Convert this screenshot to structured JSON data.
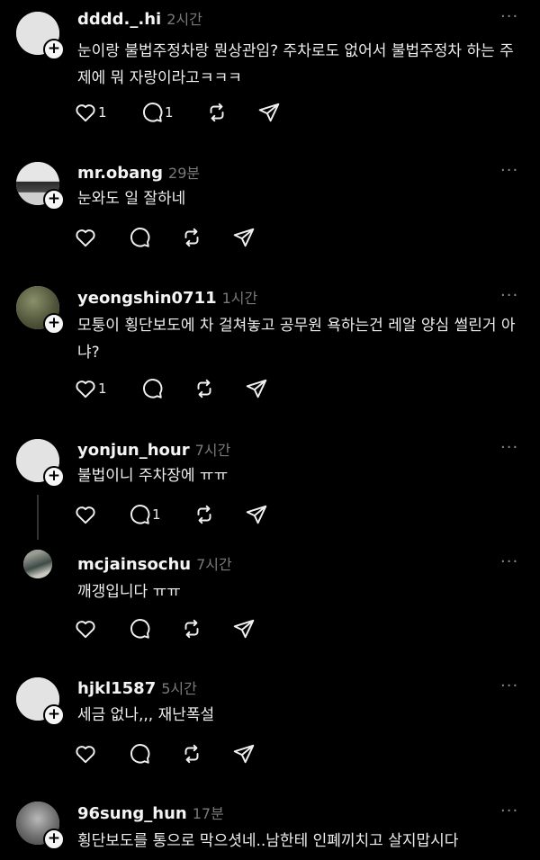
{
  "icons": {
    "like": "heart-icon",
    "reply": "reply-bubble-icon",
    "repost": "repost-icon",
    "share": "share-send-icon",
    "more": "more-dots-icon",
    "follow": "plus-icon"
  },
  "ui": {
    "more_glyph": "···",
    "follow_glyph": "+"
  },
  "colors": {
    "background": "#000000",
    "text": "#eeeeee",
    "muted": "#7a7a7a"
  },
  "comments": [
    {
      "username": "dddd._.hi",
      "time": "2시간",
      "text": "눈이랑 불법주정차랑 뭔상관임? 주차로도 없어서 불법주정차 하는 주제에 뭐 자랑이라고ㅋㅋㅋ",
      "likes": "1",
      "replies": "1"
    },
    {
      "username": "mr.obang",
      "time": "29분",
      "text": "눈와도 일 잘하네",
      "likes": "",
      "replies": ""
    },
    {
      "username": "yeongshin0711",
      "time": "1시간",
      "text": "모퉁이 횡단보도에 차 걸쳐놓고 공무원 욕하는건 레알 양심 썰린거 아냐?",
      "likes": "1",
      "replies": ""
    },
    {
      "username": "yonjun_hour",
      "time": "7시간",
      "text": "불법이니 주차장에 ㅠㅠ",
      "likes": "",
      "replies": "1"
    },
    {
      "username": "mcjainsochu",
      "time": "7시간",
      "text": "깨갱입니다 ㅠㅠ",
      "likes": "",
      "replies": ""
    },
    {
      "username": "hjkl1587",
      "time": "5시간",
      "text": "세금 없나,,, 재난폭설",
      "likes": "",
      "replies": ""
    },
    {
      "username": "96sung_hun",
      "time": "17분",
      "text": "횡단보도를 통으로 막으셧네..남한테 인폐끼치고 살지맙시다",
      "likes": "",
      "replies": ""
    }
  ]
}
